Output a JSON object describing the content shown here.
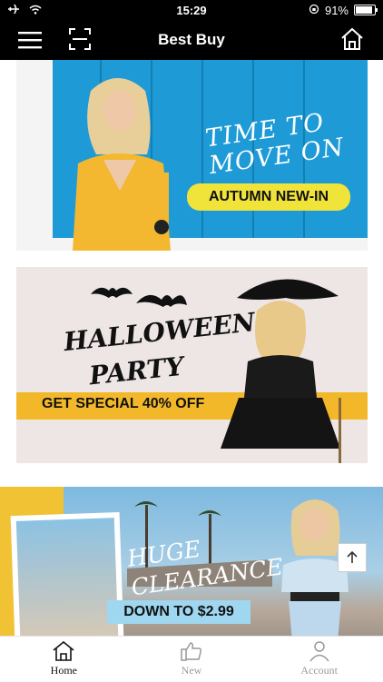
{
  "status_bar": {
    "time": "15:29",
    "battery": "91%"
  },
  "app_bar": {
    "title": "Best Buy"
  },
  "banners": [
    {
      "headline_line1": "TIME TO",
      "headline_line2": "MOVE ON",
      "tag": "AUTUMN NEW-IN"
    },
    {
      "headline_line1": "HALLOWEEN",
      "headline_line2": "PARTY",
      "tag": "GET SPECIAL 40% OFF"
    },
    {
      "headline_line1": "HUGE",
      "headline_line2": "CLEARANCE",
      "tag": "DOWN TO $2.99"
    }
  ],
  "tabs": [
    {
      "label": "Home",
      "icon": "home-icon"
    },
    {
      "label": "New",
      "icon": "thumbs-up-icon"
    },
    {
      "label": "Account",
      "icon": "person-icon"
    }
  ],
  "colors": {
    "accent_yellow": "#f0e33a",
    "halloween_yellow": "#f2b82a",
    "door_blue": "#1e9ad6"
  }
}
